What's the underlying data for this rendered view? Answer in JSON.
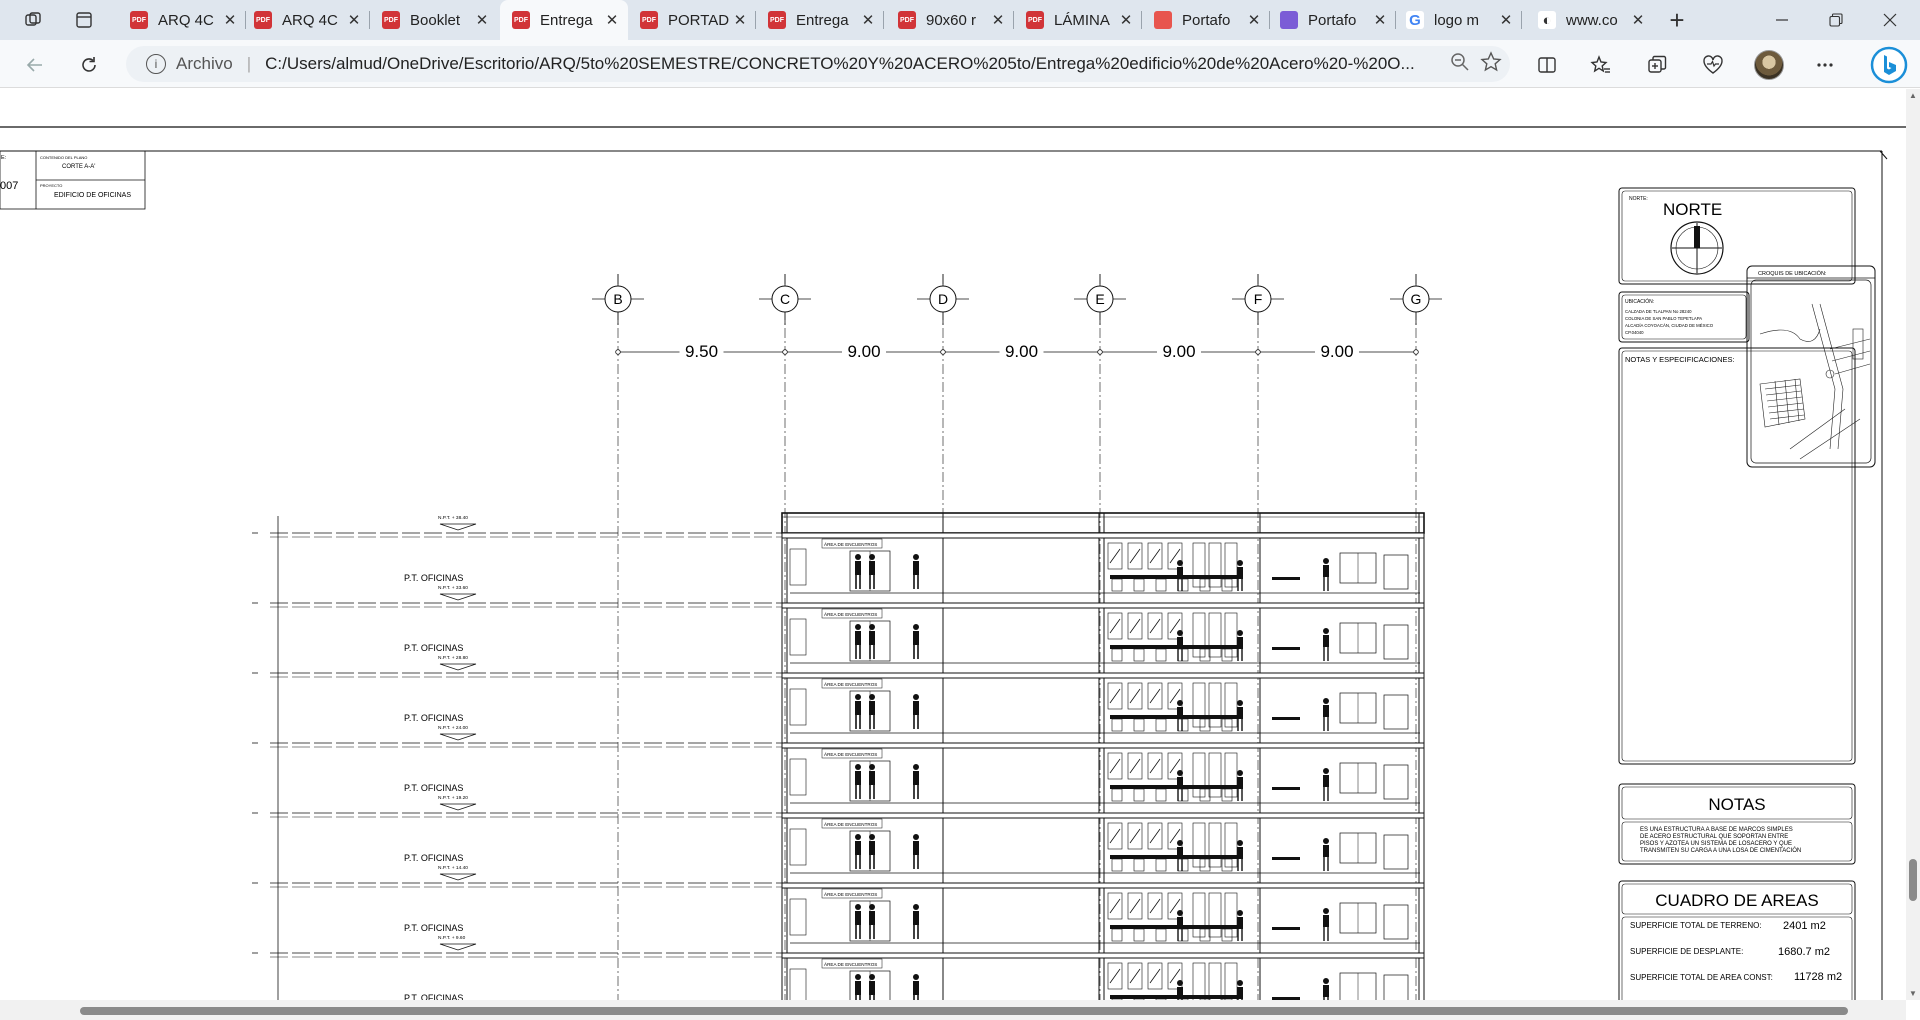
{
  "browser": {
    "tabs": [
      {
        "label": "ARQ 4C",
        "icon": "pdf-icon"
      },
      {
        "label": "ARQ 4C",
        "icon": "pdf-icon"
      },
      {
        "label": "Booklet",
        "icon": "pdf-icon"
      },
      {
        "label": "Entrega",
        "icon": "pdf-icon",
        "active": true
      },
      {
        "label": "PORTAD",
        "icon": "pdf-icon"
      },
      {
        "label": "Entrega",
        "icon": "pdf-icon"
      },
      {
        "label": "90x60 r",
        "icon": "pdf-icon"
      },
      {
        "label": "LÁMINA",
        "icon": "pdf-icon"
      },
      {
        "label": "Portafo",
        "icon": "portfolio-icon"
      },
      {
        "label": "Portafo",
        "icon": "canva-icon"
      },
      {
        "label": "logo m",
        "icon": "google-icon"
      },
      {
        "label": "www.co",
        "icon": "web-icon"
      }
    ],
    "new_tab_symbol": "+",
    "address": {
      "scheme_label": "Archivo",
      "url": "C:/Users/almud/OneDrive/Escritorio/ARQ/5to%20SEMESTRE/CONCRETO%20Y%20ACERO%205to/Entrega%20edificio%20de%20Acero%20-%20O..."
    }
  },
  "drawing": {
    "title_block": {
      "small_label_1": "CONTENIDO DEL PLANO",
      "sheet_name": "CORTE A-A'",
      "small_label_2": "PROYECTO",
      "project_name": "EDIFICIO DE OFICINAS",
      "edge_text_1": "E:",
      "edge_text_2": "007"
    },
    "axes": [
      {
        "label": "B"
      },
      {
        "label": "C"
      },
      {
        "label": "D"
      },
      {
        "label": "E"
      },
      {
        "label": "F"
      },
      {
        "label": "G"
      }
    ],
    "spacings": [
      "9.50",
      "9.00",
      "9.00",
      "9.00",
      "9.00"
    ],
    "levels": [
      {
        "name": "",
        "npt": "N.P.T. + 38.40"
      },
      {
        "name": "P.T. OFICINAS",
        "npt": "N.P.T. + 33.60"
      },
      {
        "name": "P.T. OFICINAS",
        "npt": "N.P.T. + 28.80"
      },
      {
        "name": "P.T. OFICINAS",
        "npt": "N.P.T. + 24.00"
      },
      {
        "name": "P.T. OFICINAS",
        "npt": "N.P.T. + 19.20"
      },
      {
        "name": "P.T. OFICINAS",
        "npt": "N.P.T. + 14.40"
      },
      {
        "name": "P.T. OFICINAS",
        "npt": "N.P.T. + 9.60"
      },
      {
        "name": "P.T. OFICINAS",
        "npt": ""
      }
    ],
    "room_label": "ÁREA DE ENCUENTROS",
    "north": {
      "small_label": "NORTE:",
      "title": "NORTE"
    },
    "location": {
      "label": "UBICACIÓN:",
      "lines": [
        "CALZADA DE TLALPAN No 28240",
        "COLONIA DE SAN PABLO TEPETLAPA",
        "ALCADÍA COYOACÁN, CIUDAD DE MÉXICO",
        "CP.04040"
      ]
    },
    "sketch_label": "CROQUIS DE UBICACIÓN:",
    "specs_label": "NOTAS Y ESPECIFICACIONES:",
    "notes": {
      "title": "NOTAS",
      "lines": [
        "ES UNA ESTRUCTURA A BASE DE MARCOS SIMPLES",
        "DE ACERO ESTRUCTURAL QUE SOPORTAN ENTRE",
        "PISOS Y AZOTEA UN SISTEMA DE LOSACERO Y QUE",
        "TRANSMITEN SU CARGA A UNA LOSA DE CIMENTACIÓN"
      ]
    },
    "areas": {
      "title": "CUADRO DE AREAS",
      "rows": [
        {
          "label": "SUPERFICIE TOTAL DE TERRENO:",
          "value": "2401 m2"
        },
        {
          "label": "SUPERFICIE DE DESPLANTE:",
          "value": "1680.7 m2"
        },
        {
          "label": "SUPERFICIE TOTAL DE AREA CONST:",
          "value": "11728 m2"
        }
      ]
    }
  }
}
